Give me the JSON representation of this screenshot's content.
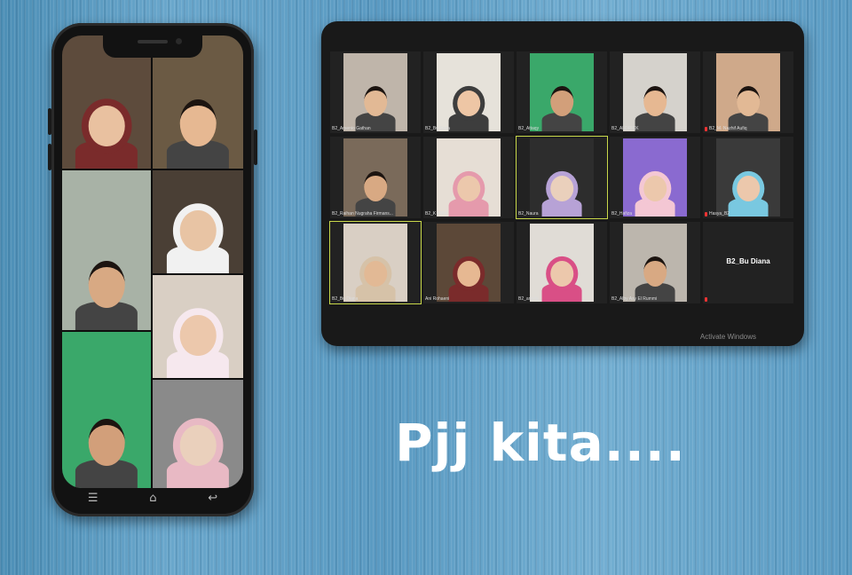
{
  "caption": "Pjj kita....",
  "watermark": "Activate Windows",
  "phone": {
    "nav": {
      "menu_icon": "menu-icon",
      "home_icon": "home-icon",
      "back_icon": "back-icon"
    },
    "tiles": [
      {
        "bg": "#5d4b3c",
        "skin": "#e9c1a0",
        "hijab": "#7a2b2b"
      },
      {
        "bg": "#6b5a44",
        "skin": "#e6b892",
        "hijab": ""
      },
      {
        "bg": "#4a3f35",
        "skin": "#e8c4a4",
        "hijab": "#f1f1f1"
      },
      {
        "bg": "#a8b2a6",
        "skin": "#d8a983",
        "hijab": ""
      },
      {
        "bg": "#d9cfc4",
        "skin": "#ecc8ac",
        "hijab": "#f6e8ee"
      },
      {
        "bg": "#3aa86a",
        "skin": "#d29f7a",
        "hijab": ""
      },
      {
        "bg": "#8a8a8a",
        "skin": "#ead0bc",
        "hijab": "#e8b9c4"
      }
    ]
  },
  "zoom": {
    "tiles": [
      {
        "name": "B2_Arsenio Gathan",
        "bg": "#bfb5aa",
        "skin": "#e2b995",
        "hijab": "",
        "active": false,
        "muted": false
      },
      {
        "name": "B2_Bu Sona",
        "bg": "#e6e2da",
        "skin": "#eec6a5",
        "hijab": "#3d3d3d",
        "active": false,
        "muted": false
      },
      {
        "name": "B2_Attaqy",
        "bg": "#3aa86a",
        "skin": "#d29f7a",
        "hijab": "",
        "active": false,
        "muted": false
      },
      {
        "name": "B2_ALDRICK",
        "bg": "#d5d2cc",
        "skin": "#e6b892",
        "hijab": "",
        "active": false,
        "muted": false
      },
      {
        "name": "B2_M. Nazhif Aufiq",
        "bg": "#cfa98a",
        "skin": "#e2b995",
        "hijab": "",
        "active": false,
        "muted": true
      },
      {
        "name": "B2_Raihan Nugraha Firmans...",
        "bg": "#7a6a5a",
        "skin": "#d8a983",
        "hijab": "",
        "active": false,
        "muted": false
      },
      {
        "name": "B2_K ANNI",
        "bg": "#e6ded5",
        "skin": "#ecc8ac",
        "hijab": "#e59aac",
        "active": false,
        "muted": false
      },
      {
        "name": "B2_Naura",
        "bg": "#2d2d2d",
        "skin": "#ead0bc",
        "hijab": "#b7a2d6",
        "active": true,
        "muted": false
      },
      {
        "name": "B2_Hafiza",
        "bg": "#8a6ad0",
        "skin": "#ecc8ac",
        "hijab": "#f4c7d4",
        "active": false,
        "muted": false
      },
      {
        "name": "Hasya_B2",
        "bg": "#3a3a3a",
        "skin": "#ecc8ac",
        "hijab": "#79c8e0",
        "active": false,
        "muted": true
      },
      {
        "name": "B2_Bu Diana",
        "bg": "#d9cfc4",
        "skin": "#e2b995",
        "hijab": "#d6c2a8",
        "active": true,
        "muted": false
      },
      {
        "name": "Ani Rohaeni",
        "bg": "#5c4838",
        "skin": "#e6b892",
        "hijab": "#7a2b2b",
        "active": false,
        "muted": false
      },
      {
        "name": "B2_arsyfa",
        "bg": "#e0dcd6",
        "skin": "#ecc8ac",
        "hijab": "#d94f86",
        "active": false,
        "muted": false
      },
      {
        "name": "B2_Alby Asy El Rummi",
        "bg": "#bcb6ad",
        "skin": "#d8a983",
        "hijab": "",
        "active": false,
        "muted": false
      },
      {
        "name": "B2_Bu Diana",
        "bg": "#222222",
        "skin": "",
        "hijab": "",
        "active": false,
        "muted": true,
        "text_only": true
      }
    ]
  }
}
